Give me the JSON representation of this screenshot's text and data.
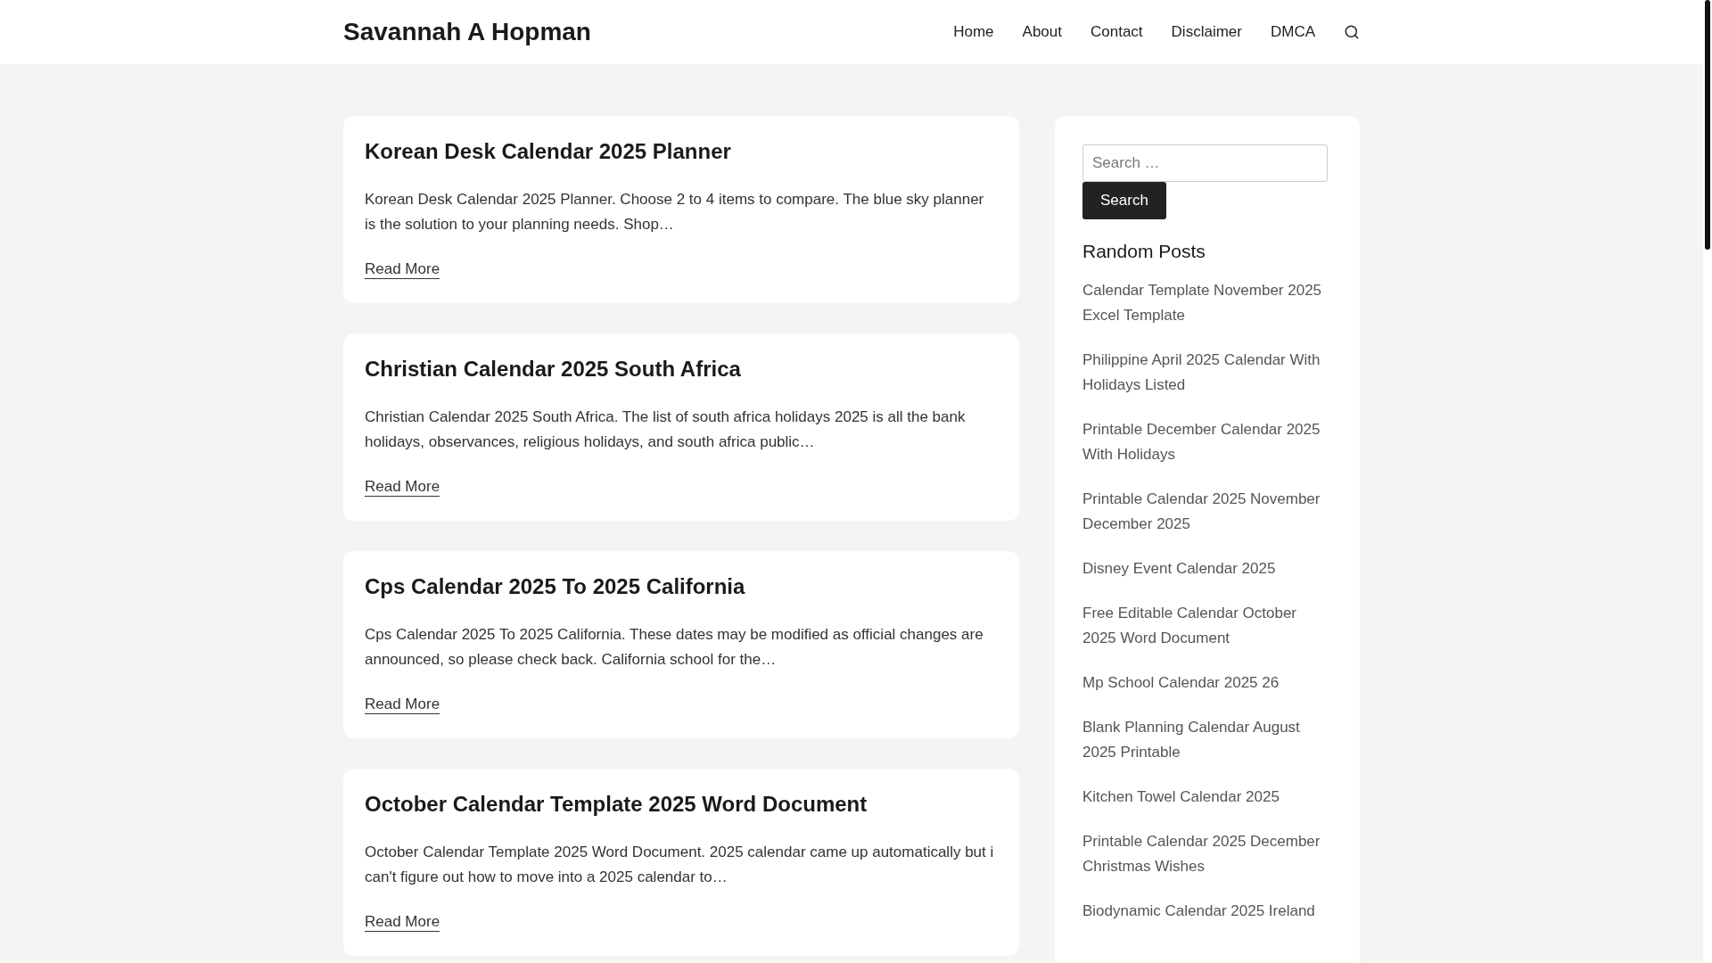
{
  "header": {
    "site_title": "Savannah A Hopman",
    "nav": [
      {
        "label": "Home"
      },
      {
        "label": "About"
      },
      {
        "label": "Contact"
      },
      {
        "label": "Disclaimer"
      },
      {
        "label": "DMCA"
      }
    ]
  },
  "posts": [
    {
      "title": "Korean Desk Calendar 2025 Planner",
      "excerpt": "Korean Desk Calendar 2025 Planner. Choose 2 to 4 items to compare. The blue sky planner is the solution to your planning needs. Shop…",
      "link": "Read More"
    },
    {
      "title": "Christian Calendar 2025 South Africa",
      "excerpt": "Christian Calendar 2025 South Africa. The list of south africa holidays 2025 is all the bank holidays, observances, religious holidays, and south africa public…",
      "link": "Read More"
    },
    {
      "title": "Cps Calendar 2025 To 2025 California",
      "excerpt": "Cps Calendar 2025 To 2025 California. These dates may be modified as official changes are announced, so please check back. California school for the…",
      "link": "Read More"
    },
    {
      "title": "October Calendar Template 2025 Word Document",
      "excerpt": "October Calendar Template 2025 Word Document. 2025 calendar came up automatically but i can't figure out how to move into a 2025 calendar to…",
      "link": "Read More"
    }
  ],
  "sidebar": {
    "search": {
      "placeholder": "Search …",
      "button": "Search"
    },
    "random_posts": {
      "heading": "Random Posts",
      "items": [
        "Calendar Template November 2025 Excel Template",
        "Philippine April 2025 Calendar With Holidays Listed",
        "Printable December Calendar 2025 With Holidays",
        "Printable Calendar 2025 November December 2025",
        "Disney Event Calendar 2025",
        "Free Editable Calendar October 2025 Word Document",
        "Mp School Calendar 2025 26",
        "Blank Planning Calendar August 2025 Printable",
        "Kitchen Towel Calendar 2025",
        "Printable Calendar 2025 December Christmas Wishes",
        "Biodynamic Calendar 2025 Ireland"
      ]
    }
  }
}
